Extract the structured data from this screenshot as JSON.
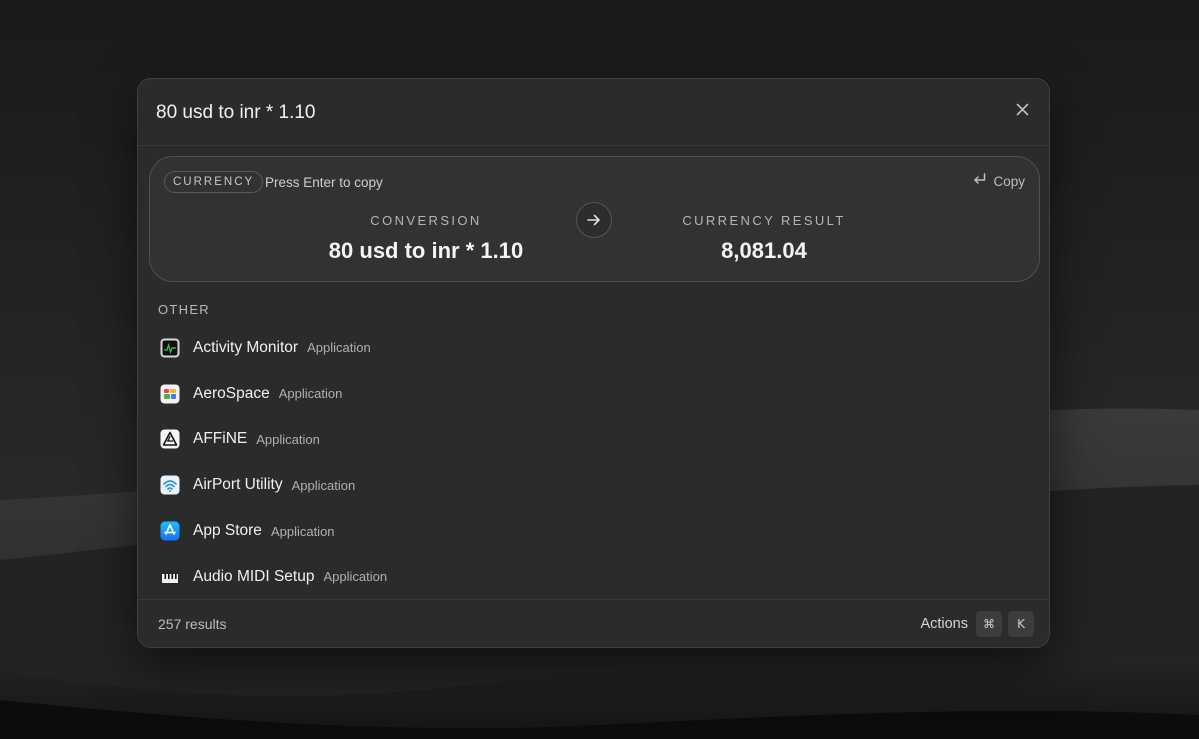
{
  "search": {
    "query": "80 usd to inr * 1.10"
  },
  "currency_card": {
    "tag": "CURRENCY",
    "hint": "Press Enter to copy",
    "copy_label": "Copy",
    "conversion_label": "CONVERSION",
    "conversion_value": "80 usd to inr * 1.10",
    "result_label": "CURRENCY RESULT",
    "result_value": "8,081.04"
  },
  "section": {
    "label": "OTHER"
  },
  "results": [
    {
      "name": "Activity Monitor",
      "type": "Application",
      "icon": "activity-monitor-icon"
    },
    {
      "name": "AeroSpace",
      "type": "Application",
      "icon": "aerospace-icon"
    },
    {
      "name": "AFFiNE",
      "type": "Application",
      "icon": "affine-icon"
    },
    {
      "name": "AirPort Utility",
      "type": "Application",
      "icon": "airport-utility-icon"
    },
    {
      "name": "App Store",
      "type": "Application",
      "icon": "app-store-icon"
    },
    {
      "name": "Audio MIDI Setup",
      "type": "Application",
      "icon": "audio-midi-setup-icon"
    }
  ],
  "footer": {
    "result_count": "257 results",
    "actions_label": "Actions",
    "shortcut_modifier": "⌘",
    "shortcut_key": "K"
  }
}
